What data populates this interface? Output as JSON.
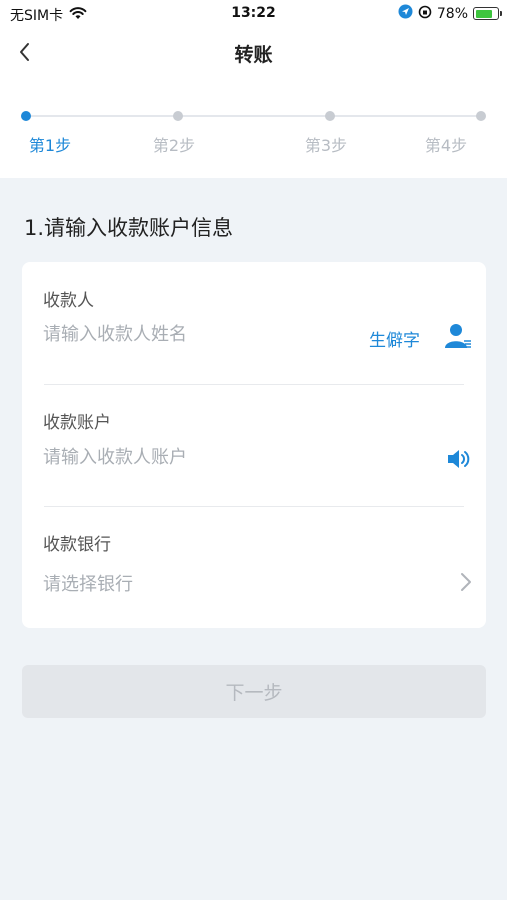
{
  "status_bar": {
    "carrier": "无SIM卡",
    "time": "13:22",
    "battery": "78%",
    "battery_fraction": 0.78
  },
  "nav": {
    "title": "转账"
  },
  "stepper": {
    "steps": [
      {
        "label": "第1步",
        "active": true
      },
      {
        "label": "第2步",
        "active": false
      },
      {
        "label": "第3步",
        "active": false
      },
      {
        "label": "第4步",
        "active": false
      }
    ]
  },
  "section": {
    "title": "1.请输入收款账户信息"
  },
  "form": {
    "payee": {
      "label": "收款人",
      "placeholder": "请输入收款人姓名",
      "rare_char_link": "生僻字",
      "icon": "contact-icon"
    },
    "account": {
      "label": "收款账户",
      "placeholder": "请输入收款人账户",
      "icon": "speaker-icon"
    },
    "bank": {
      "label": "收款银行",
      "placeholder": "请选择银行",
      "icon": "chevron-right-icon"
    }
  },
  "actions": {
    "next_label": "下一步"
  },
  "colors": {
    "accent": "#1e88d8",
    "background": "#eff3f7",
    "disabled_button": "#e3e6ea"
  }
}
